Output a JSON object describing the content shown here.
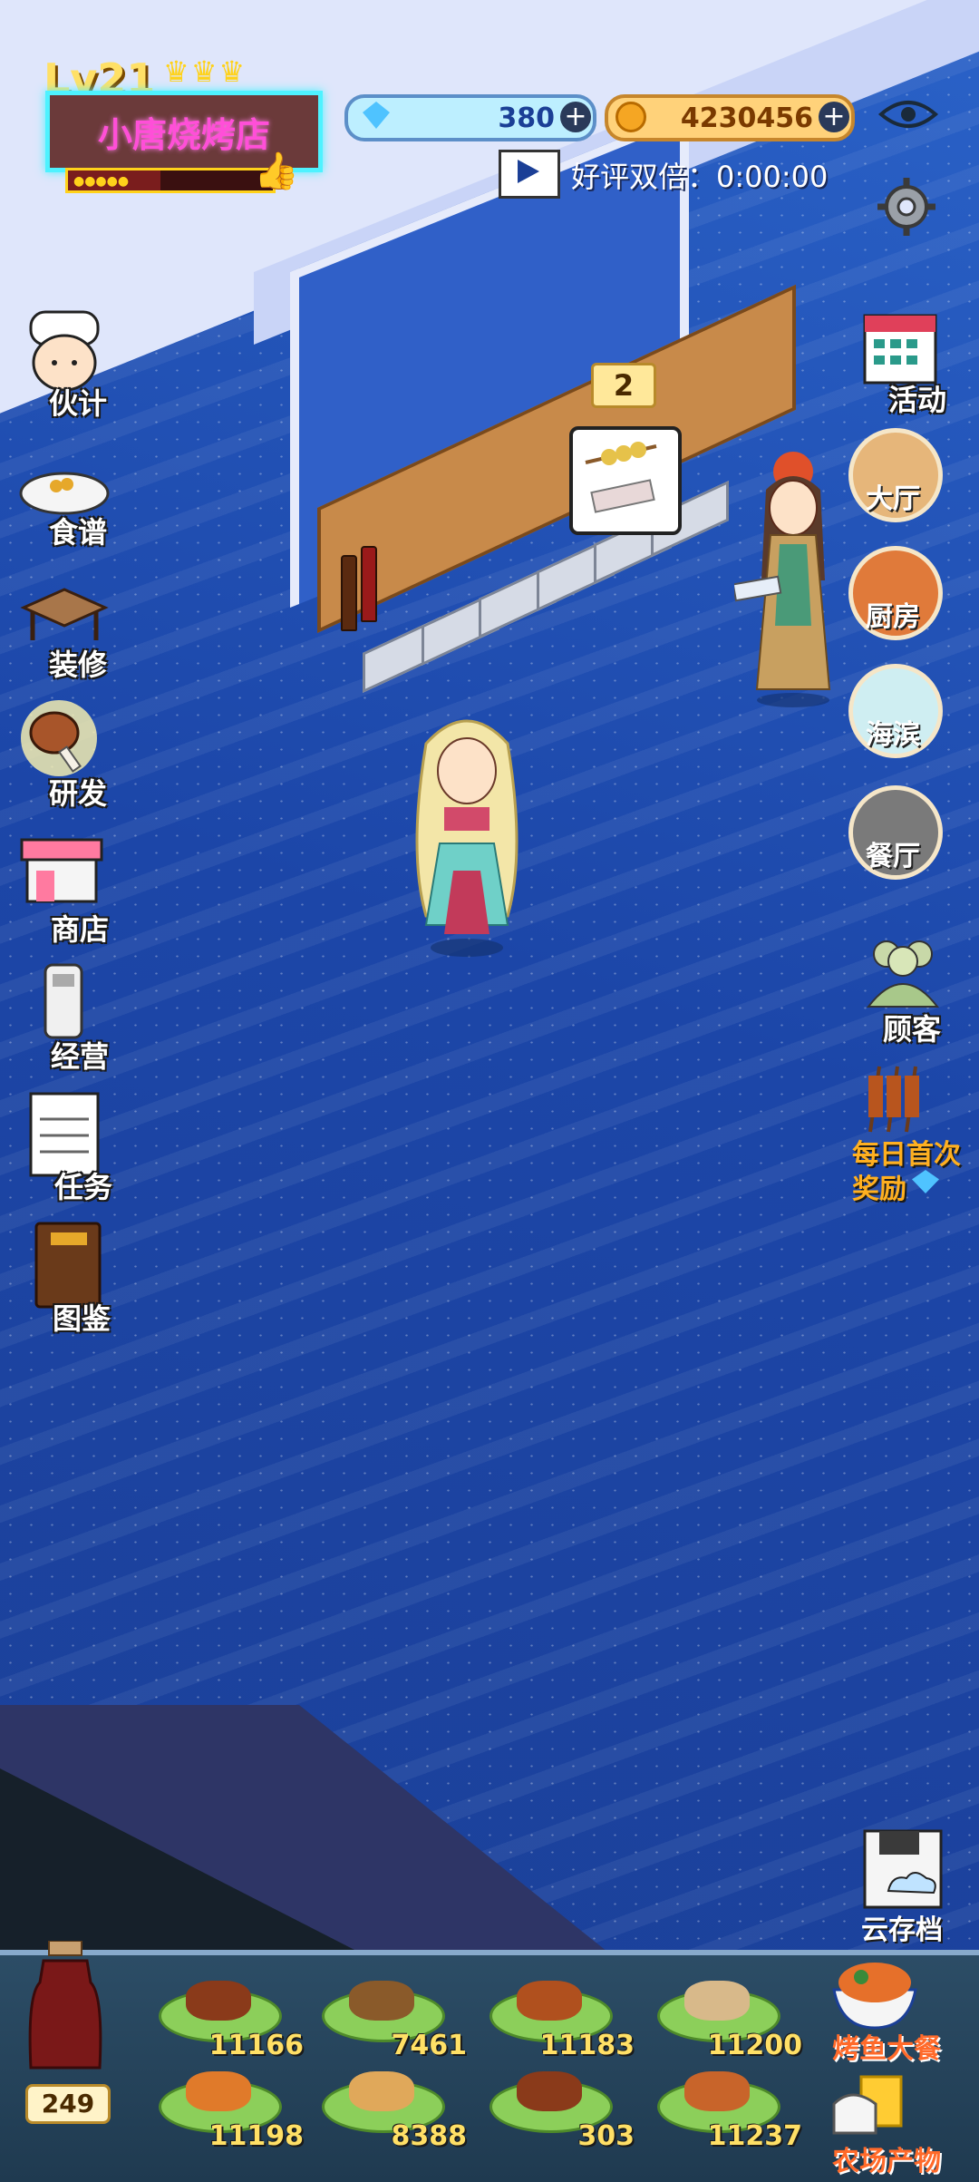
{
  "hud": {
    "level": "Lv21",
    "crowns": "♛♛♛",
    "shop_name": "小唐烧烤店",
    "level_progress": 0.45,
    "gems": "380",
    "coins": "4230456",
    "ad_text": "好评双倍：0:00:00"
  },
  "left_menu": [
    {
      "label": "伙计"
    },
    {
      "label": "食谱"
    },
    {
      "label": "装修"
    },
    {
      "label": "研发"
    },
    {
      "label": "商店"
    },
    {
      "label": "经营"
    },
    {
      "label": "任务"
    },
    {
      "label": "图鉴"
    }
  ],
  "right_menu": {
    "activity": "活动",
    "hall": "大厅",
    "kitchen": "厨房",
    "seaside": "海滨",
    "restaurant": "餐厅",
    "customers": "顾客",
    "daily_reward_line1": "每日首次",
    "daily_reward_line2": "奖励",
    "cloud_save": "云存档",
    "grilled_fish": "烤鱼大餐",
    "farm_products": "农场产物"
  },
  "order": {
    "count": "2"
  },
  "inventory": {
    "potion_count": "249",
    "foods": [
      {
        "count": "11166",
        "color": "#8a3a1a"
      },
      {
        "count": "7461",
        "color": "#8a5a2a"
      },
      {
        "count": "11183",
        "color": "#b0501e"
      },
      {
        "count": "11200",
        "color": "#d8b98a"
      },
      {
        "count": "11198",
        "color": "#e07a2a"
      },
      {
        "count": "8388",
        "color": "#e0a85a"
      },
      {
        "count": "303",
        "color": "#8a3a1a"
      },
      {
        "count": "11237",
        "color": "#c8642a"
      }
    ]
  },
  "colors": {
    "floor": "#1f4fb0",
    "wall": "#dfe6fb",
    "accent": "#ffe066"
  }
}
